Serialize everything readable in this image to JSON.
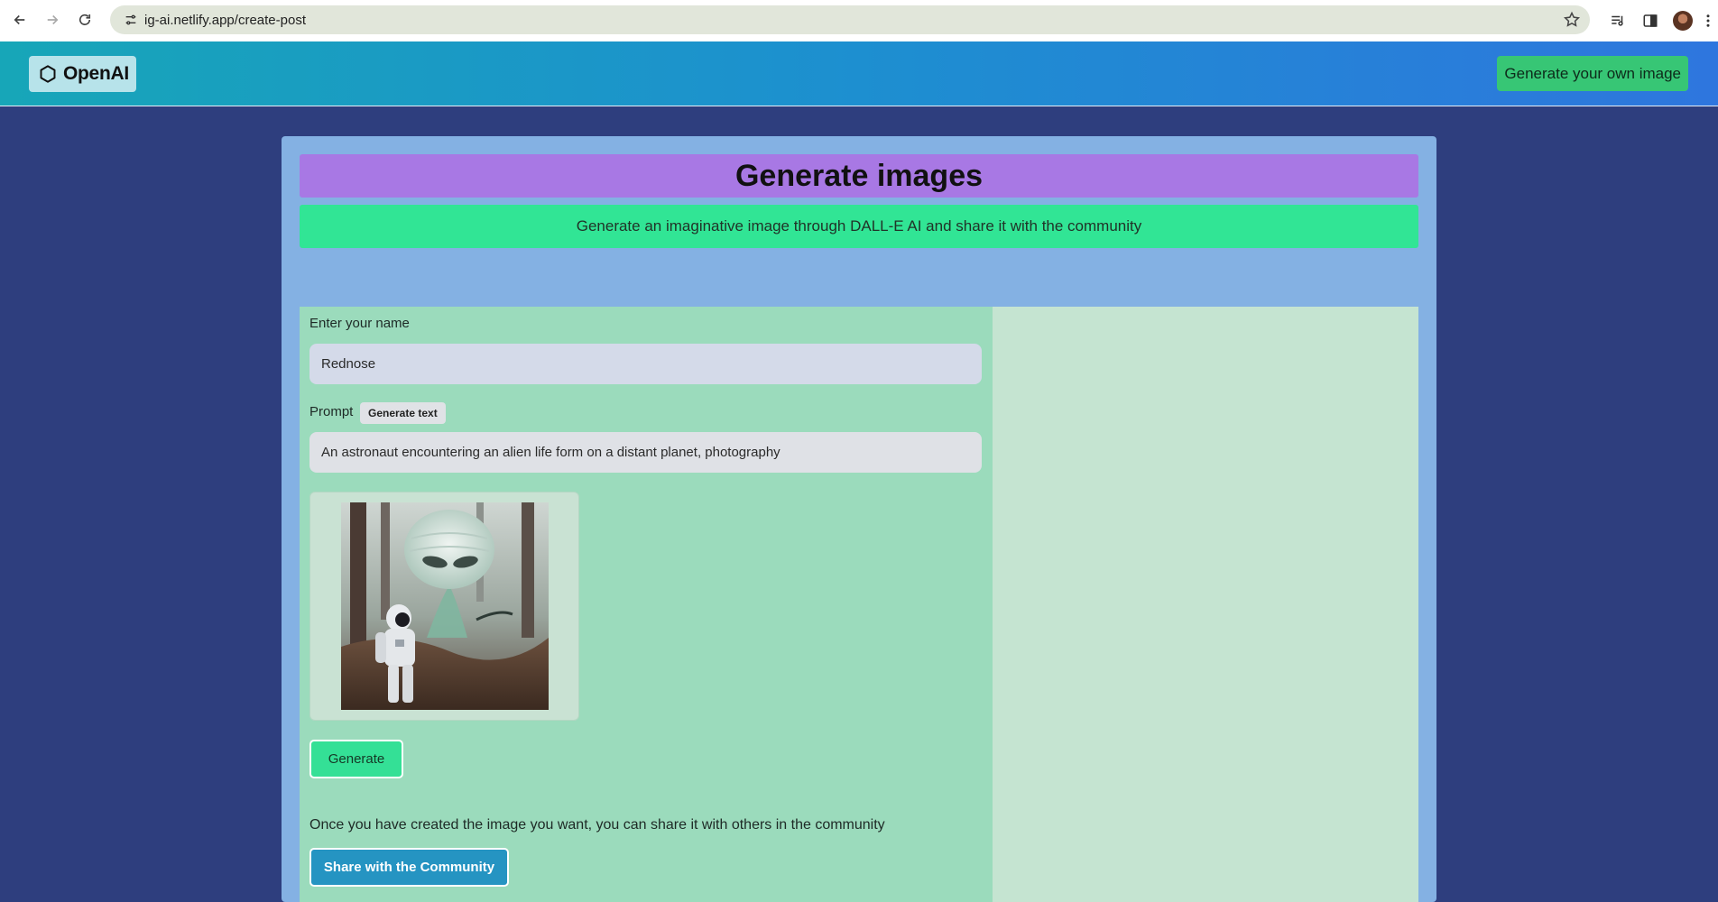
{
  "browser": {
    "url": "ig-ai.netlify.app/create-post",
    "icons": [
      "back-arrow-icon",
      "forward-arrow-icon",
      "reload-icon",
      "site-settings-icon",
      "bookmark-star-icon",
      "media-controls-icon",
      "side-panel-icon",
      "profile-avatar",
      "more-menu-icon"
    ]
  },
  "header": {
    "logo_text": "OpenAI",
    "cta_label": "Generate your own image"
  },
  "main": {
    "title": "Generate images",
    "subtitle": "Generate an imaginative image through DALL-E AI and share it with the community"
  },
  "form": {
    "name_label": "Enter your name",
    "name_value": "Rednose",
    "prompt_label": "Prompt",
    "generate_text_label": "Generate text",
    "prompt_value": "An astronaut encountering an alien life form on a distant planet, photography",
    "generate_label": "Generate",
    "share_note": "Once you have created the image you want, you can share it with others in the community",
    "share_label": "Share with the Community"
  },
  "colors": {
    "page_background": "#2e3e7e",
    "header_gradient_start": "#17a6b8",
    "header_gradient_end": "#2e76de",
    "panel": "#84b1e3",
    "title_bar": "#a878e4",
    "subtitle_bar": "#31e595",
    "form_area": "#9bdbbc",
    "preview_area": "#c5e4d1",
    "generate_button": "#34e096",
    "share_button": "#2594c2",
    "cta_button": "#37c675"
  }
}
